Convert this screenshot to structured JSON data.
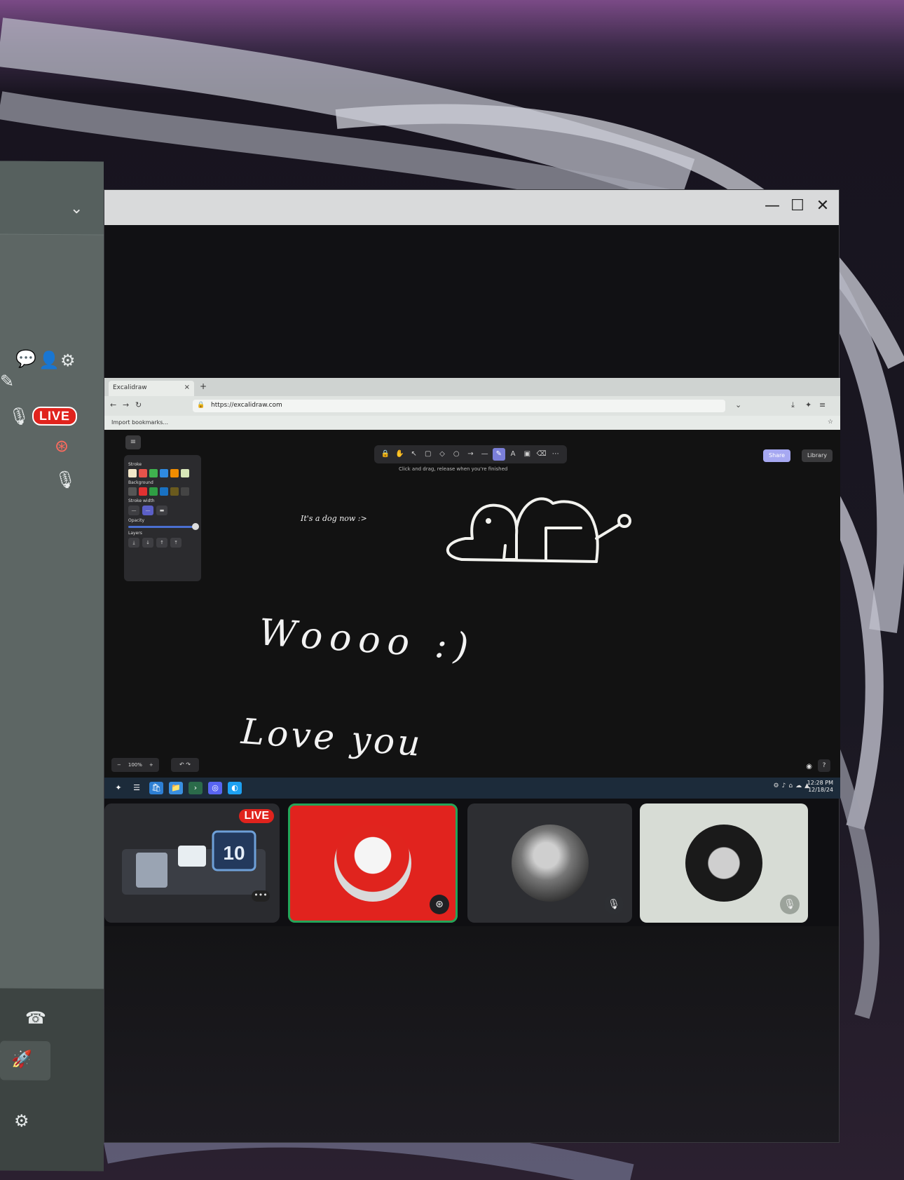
{
  "side_panel": {
    "live_badge": "LIVE"
  },
  "window": {
    "minimize_label": "—",
    "maximize_label": "☐",
    "close_label": "✕"
  },
  "browser": {
    "tab_title": "Excalidraw",
    "tab_close": "×",
    "new_tab": "+",
    "url": "https://excalidraw.com",
    "bookmarks_label": "Import bookmarks..."
  },
  "excalidraw": {
    "hint": "Click and drag, release when you're finished",
    "share_label": "Share",
    "library_label": "Library",
    "props": {
      "stroke_label": "Stroke",
      "background_label": "Background",
      "stroke_width_label": "Stroke width",
      "opacity_label": "Opacity",
      "layers_label": "Layers",
      "stroke_colors": [
        "#f3e7c9",
        "#e6534b",
        "#3fb34f",
        "#2f8ae0",
        "#f08c00",
        "#d8e7b8"
      ],
      "bg_colors": [
        "#555555",
        "#e03131",
        "#2f9e44",
        "#1971c2",
        "#6a5a1e",
        "#444444"
      ]
    },
    "zoom": "100%",
    "zoom_out": "−",
    "zoom_in": "+",
    "canvas_texts": {
      "dog_note": "It's a dog now :>",
      "wooo": "Woooo :)",
      "love": "Love you"
    }
  },
  "taskbar": {
    "time": "12:28 PM",
    "date": "12/18/24"
  },
  "participants": [
    {
      "kind": "stream",
      "live_label": "LIVE",
      "stream_number": "10"
    },
    {
      "kind": "speaking",
      "avatar_color": "#e0241e"
    },
    {
      "kind": "muted",
      "avatar_color": "#777777"
    },
    {
      "kind": "muted",
      "avatar_color": "#1a1a1a"
    }
  ],
  "colors": {
    "speaking_outline": "#23a559",
    "live_red": "#e0231d",
    "tile_red": "#e1231e",
    "tile_light": "#d7dcd5"
  }
}
